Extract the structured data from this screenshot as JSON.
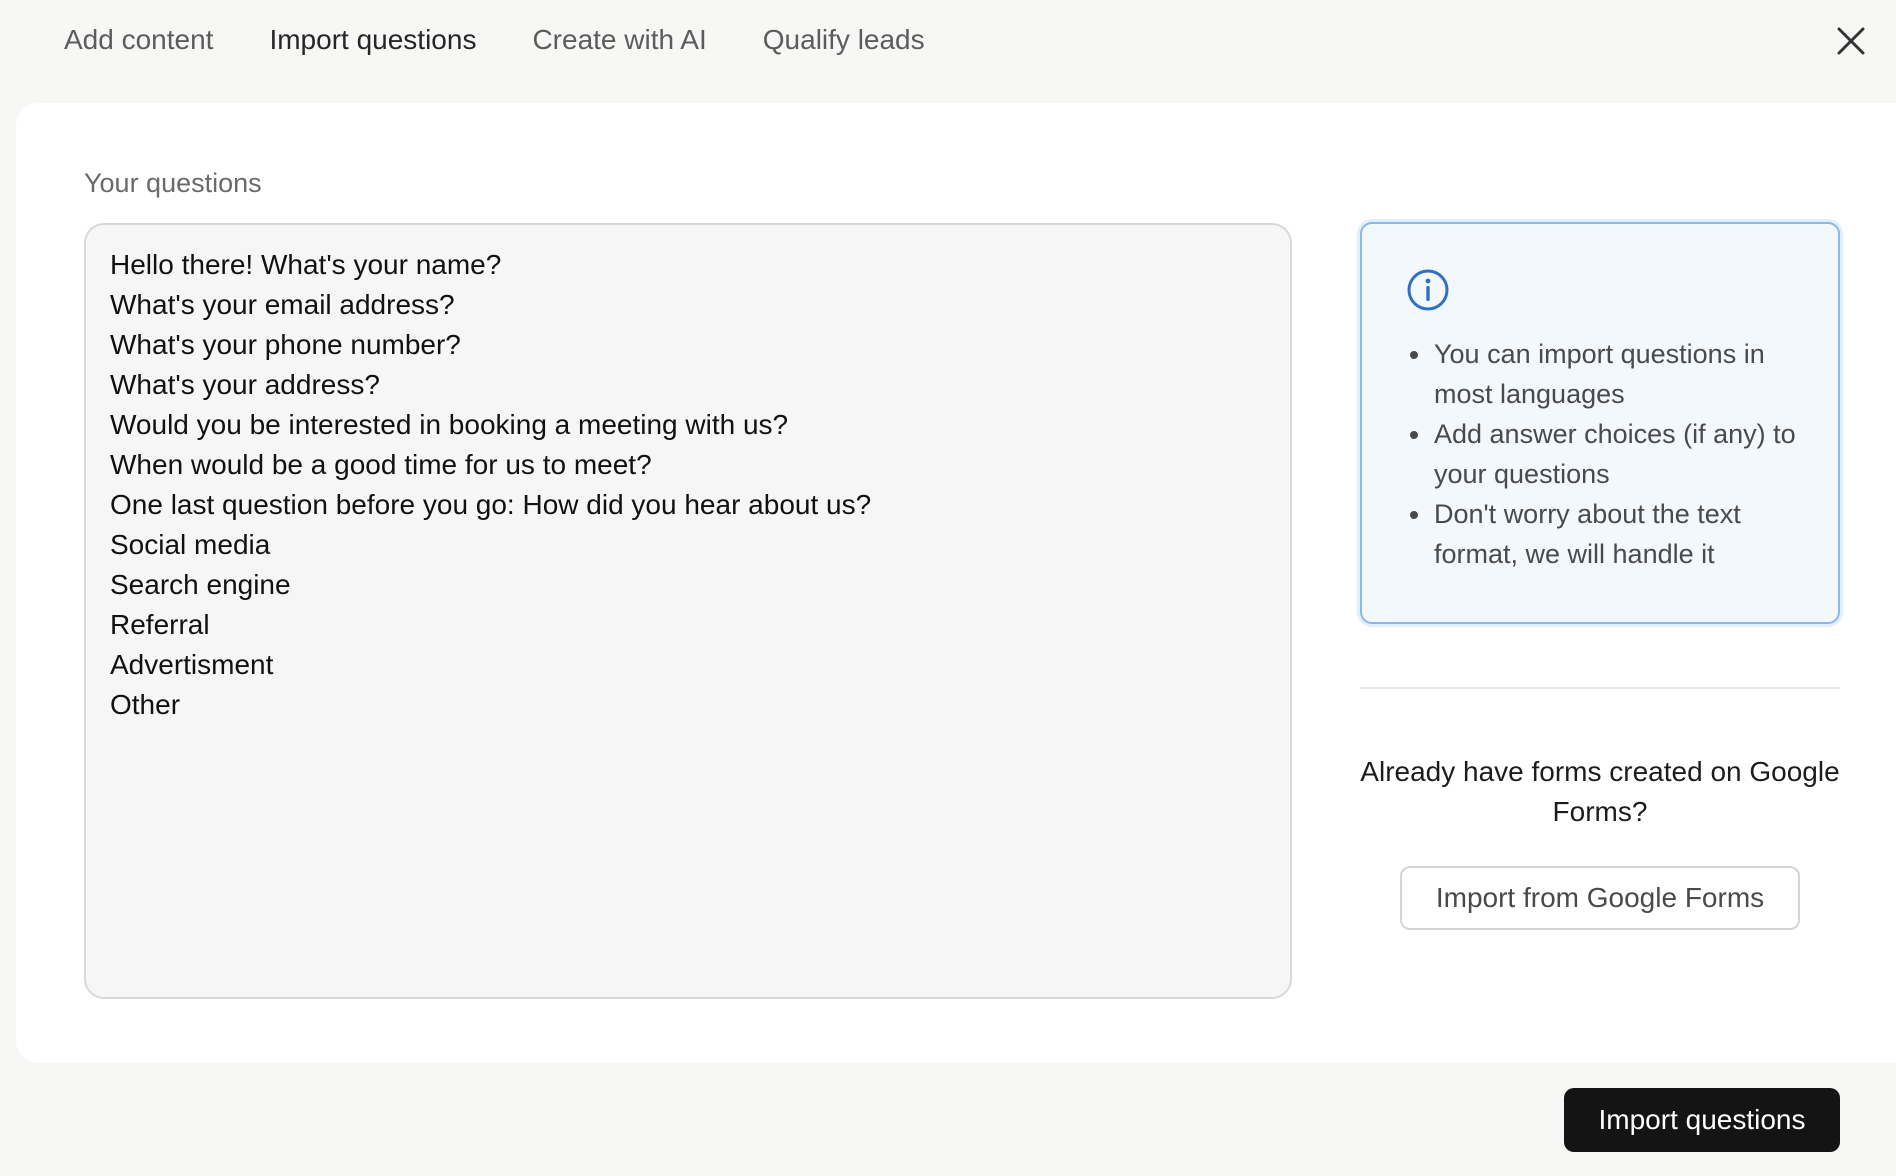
{
  "tabs": [
    {
      "label": "Add content",
      "active": false
    },
    {
      "label": "Import questions",
      "active": true
    },
    {
      "label": "Create with AI",
      "active": false
    },
    {
      "label": "Qualify leads",
      "active": false
    }
  ],
  "close_icon": "close-icon",
  "questions": {
    "label": "Your questions",
    "lines": [
      "Hello there! What's your name?",
      "What's your email address?",
      "What's your phone number?",
      "What's your address?",
      "Would you be interested in booking a meeting with us?",
      "When would be a good time for us to meet?",
      "One last question before you go: How did you hear about us?",
      "Social media",
      "Search engine",
      "Referral",
      "Advertisment",
      "Other"
    ]
  },
  "info": {
    "icon": "info-icon",
    "accent_color": "#2f6fc4",
    "tips": [
      "You can import questions in most languages",
      "Add answer choices (if any) to your questions",
      "Don't worry about the text format, we will handle it"
    ]
  },
  "google_forms": {
    "prompt": "Already have forms created on Google Forms?",
    "button_label": "Import from Google Forms"
  },
  "footer": {
    "import_button_label": "Import questions"
  }
}
